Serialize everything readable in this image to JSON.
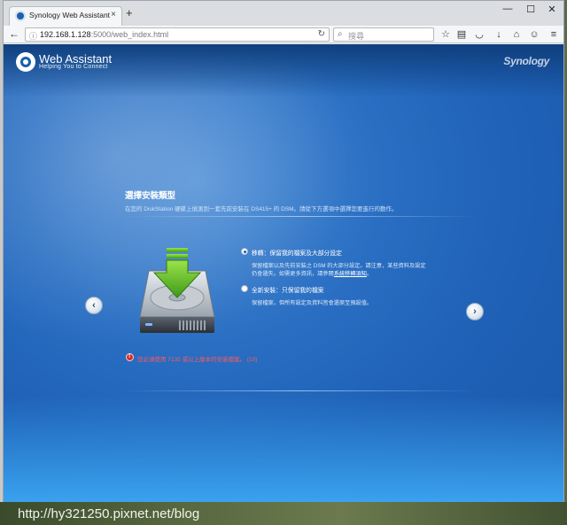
{
  "browser": {
    "tab_title": "Synology Web Assistant",
    "tab_close": "×",
    "new_tab": "+",
    "window_controls": [
      "—",
      "☐",
      "✕"
    ],
    "url_host": "192.168.1.128",
    "url_path": ":5000/web_index.html",
    "search_placeholder": "搜尋",
    "icons": [
      "back-icon",
      "info-icon",
      "reload-icon",
      "search-icon",
      "star-icon",
      "reading-list-icon",
      "pocket-icon",
      "download-icon",
      "home-icon",
      "emoji-icon",
      "menu-icon"
    ]
  },
  "header": {
    "app_title": "Web Assistant",
    "app_subtitle": "Helping You to Connect",
    "brand": "Synology"
  },
  "main": {
    "title": "選擇安裝類型",
    "description": "在您的 DiskStation 硬碟上偵測到一套先前安裝在 DS415+ 的 DSM。請從下方選項中選擇您要進行的動作。",
    "options": [
      {
        "label": "移轉：保留我的檔案及大部分設定",
        "desc_line1": "保留檔案以及先前安裝之 DSM 的大部分設定。請注意，某些資料及設定",
        "desc_line2_prefix": "仍會遺失。如需更多資訊，請參閱",
        "desc_link": "系統移轉須知",
        "desc_line2_suffix": "。",
        "checked": true
      },
      {
        "label": "全新安裝：只保留我的檔案",
        "desc_line1": "保留檔案，但所有設定及資料皆會還原至預設值。",
        "checked": false
      }
    ],
    "error": "您必須使用 7135 或以上版本的安裝檔案。 (10)",
    "prev_button": "‹",
    "next_button": "›"
  },
  "watermark": "http://hy321250.pixnet.net/blog"
}
